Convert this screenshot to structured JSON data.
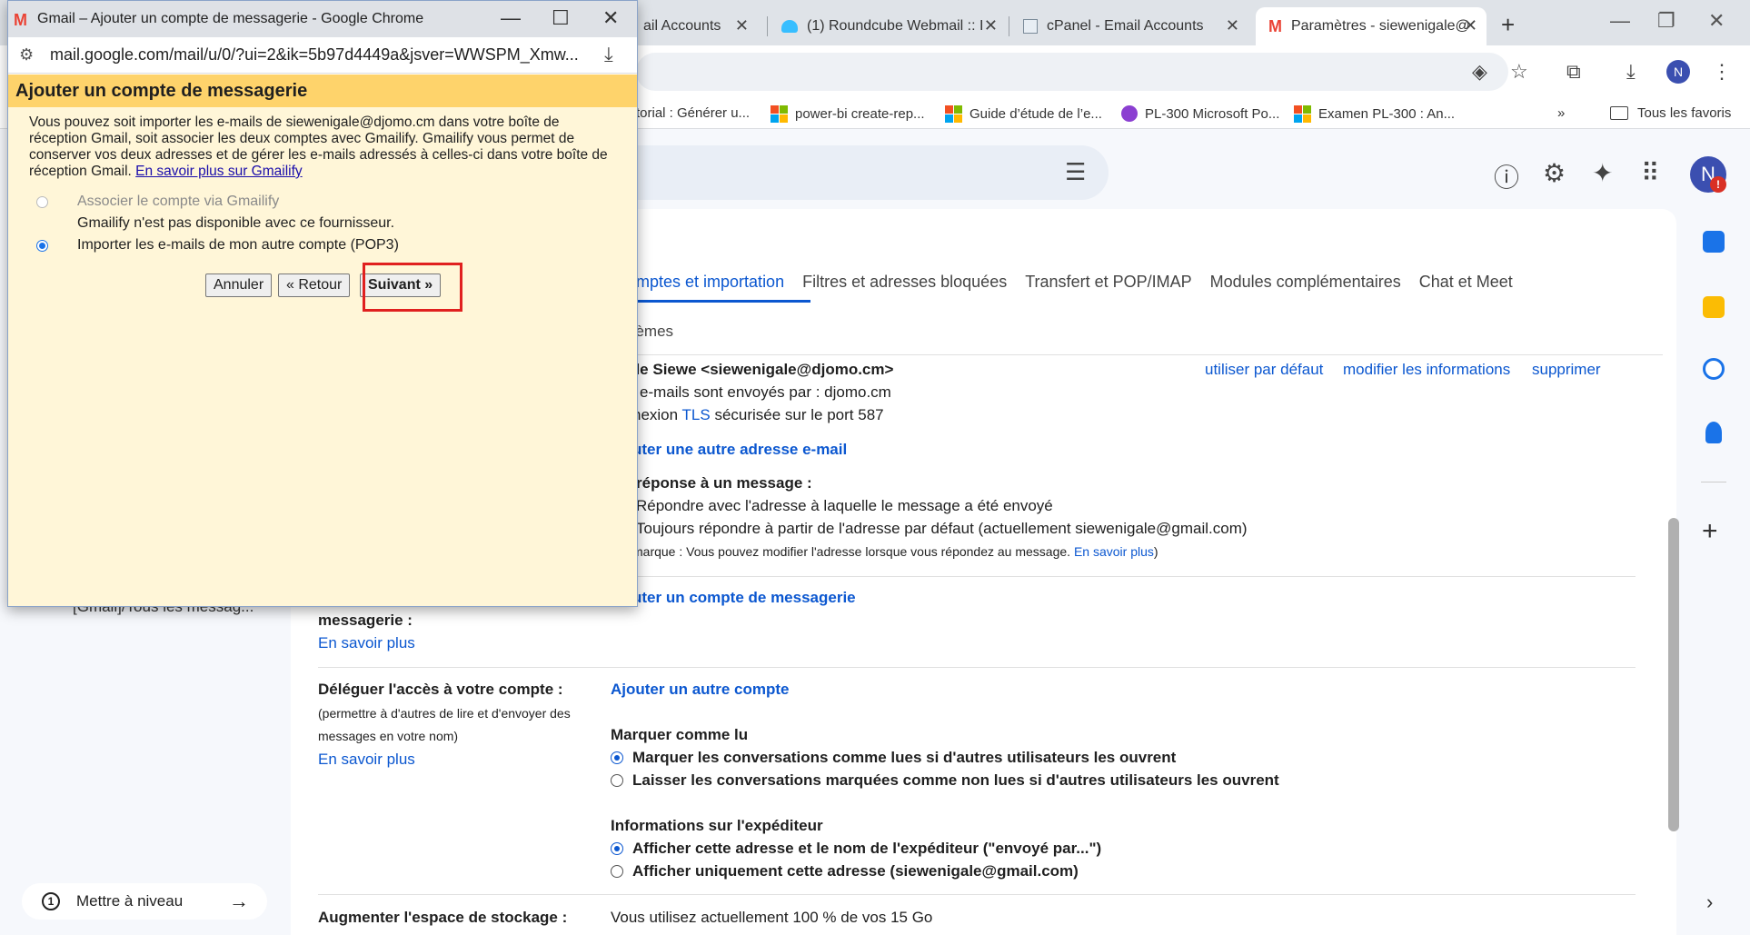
{
  "browser": {
    "tabs": [
      {
        "label": "ail Accounts",
        "icon": "generic-tab-icon"
      },
      {
        "label": "(1) Roundcube Webmail :: I",
        "icon": "roundcube-icon"
      },
      {
        "label": "cPanel - Email Accounts",
        "icon": "cpanel-icon"
      },
      {
        "label": "Paramètres - siewenigale@",
        "icon": "gmail-icon",
        "active": true
      }
    ],
    "bookmarks": [
      "torial : Générer u...",
      "power-bi create-rep...",
      "Guide d’étude de l’e...",
      "PL-300 Microsoft Po...",
      "Examen PL-300 : An..."
    ],
    "all_bookmarks": "Tous les favoris",
    "avatar_letter": "N"
  },
  "popup": {
    "window_title": "Gmail – Ajouter un compte de messagerie - Google Chrome",
    "url": "mail.google.com/mail/u/0/?ui=2&ik=5b97d4449a&jsver=WWSPM_Xmw...",
    "header": "Ajouter un compte de messagerie",
    "intro": "Vous pouvez soit importer les e-mails de siewenigale@djomo.cm dans votre boîte de réception Gmail, soit associer les deux comptes avec Gmailify. Gmailify vous permet de conserver vos deux adresses et de gérer les e-mails adressés à celles-ci dans votre boîte de réception Gmail.",
    "intro_link": "En savoir plus sur Gmailify",
    "option_gmailify": "Associer le compte via Gmailify",
    "gmailify_note": "Gmailify n'est pas disponible avec ce fournisseur.",
    "option_pop3": "Importer les e-mails de mon autre compte (POP3)",
    "btn_cancel": "Annuler",
    "btn_back": "« Retour",
    "btn_next": "Suivant »"
  },
  "settings": {
    "tabs": [
      "omptes et importation",
      "Filtres et adresses bloquées",
      "Transfert et POP/IMAP",
      "Modules complémentaires",
      "Chat et Meet"
    ],
    "tab_row2": "hèmes",
    "sender_name": "ale Siewe <siewenigale@djomo.cm>",
    "action_default": "utiliser par défaut",
    "action_edit": "modifier les informations",
    "action_delete": "supprimer",
    "sent_via": "e-mails sont envoyés par : djomo.cm",
    "conn_prefix": "nexion",
    "conn_tls": "TLS",
    "conn_suffix": "sécurisée sur le port 587",
    "add_address": "uter une autre adresse e-mail",
    "reply_heading": "réponse à un message :",
    "reply_opt1": "Répondre avec l'adresse à laquelle le message a été envoyé",
    "reply_opt2": "Toujours répondre à partir de l'adresse par défaut (actuellement siewenigale@gmail.com)",
    "note_text": "marque : Vous pouvez modifier l'adresse lorsque vous répondez au message.",
    "note_link": "En savoir plus",
    "add_account": "uter un compte de messagerie",
    "left_messagerie": "messagerie :",
    "left_learn1": "En savoir plus",
    "delegate_heading": "Déléguer l'accès à votre compte :",
    "delegate_desc1": "(permettre à d'autres de lire et d'envoyer des",
    "delegate_desc2": "messages en votre nom)",
    "left_learn2": "En savoir plus",
    "add_other_account": "Ajouter un autre compte",
    "mark_read_heading": "Marquer comme lu",
    "mark_opt1": "Marquer les conversations comme lues si d'autres utilisateurs les ouvrent",
    "mark_opt2": "Laisser les conversations marquées comme non lues si d'autres utilisateurs les ouvrent",
    "sender_info_heading": "Informations sur l'expéditeur",
    "sender_opt1": "Afficher cette adresse et le nom de l'expéditeur (\"envoyé par...\")",
    "sender_opt2": "Afficher uniquement cette adresse (siewenigale@gmail.com)",
    "storage_left": "Augmenter l'espace de stockage :",
    "storage_right": "Vous utilisez actuellement 100 % de vos 15 Go"
  },
  "leftnav": {
    "all_mail": "[Gmail]/Tous les messag...",
    "upgrade": "Mettre à niveau",
    "upgrade_num": "1"
  },
  "colors": {
    "accent": "#0b57d0",
    "popup_header": "#fed36b",
    "popup_body": "#fff6d8",
    "highlight": "#e0201f"
  }
}
